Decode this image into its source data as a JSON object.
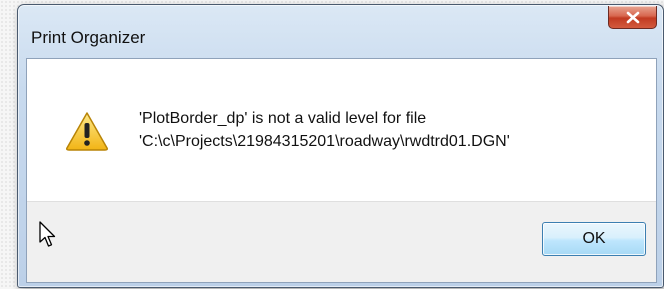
{
  "dialog": {
    "title": "Print Organizer",
    "close_icon": "close-icon",
    "message_line1": "'PlotBorder_dp' is not a valid level for file",
    "message_line2": "'C:\\c\\Projects\\21984315201\\roadway\\rwdtrd01.DGN'",
    "warning_icon": "warning-icon",
    "ok_label": "OK",
    "cursor_icon": "mouse-pointer-icon"
  },
  "colors": {
    "close_button": "#c13b22",
    "ok_border": "#3c7fb1",
    "warning_yellow": "#f5c518"
  }
}
